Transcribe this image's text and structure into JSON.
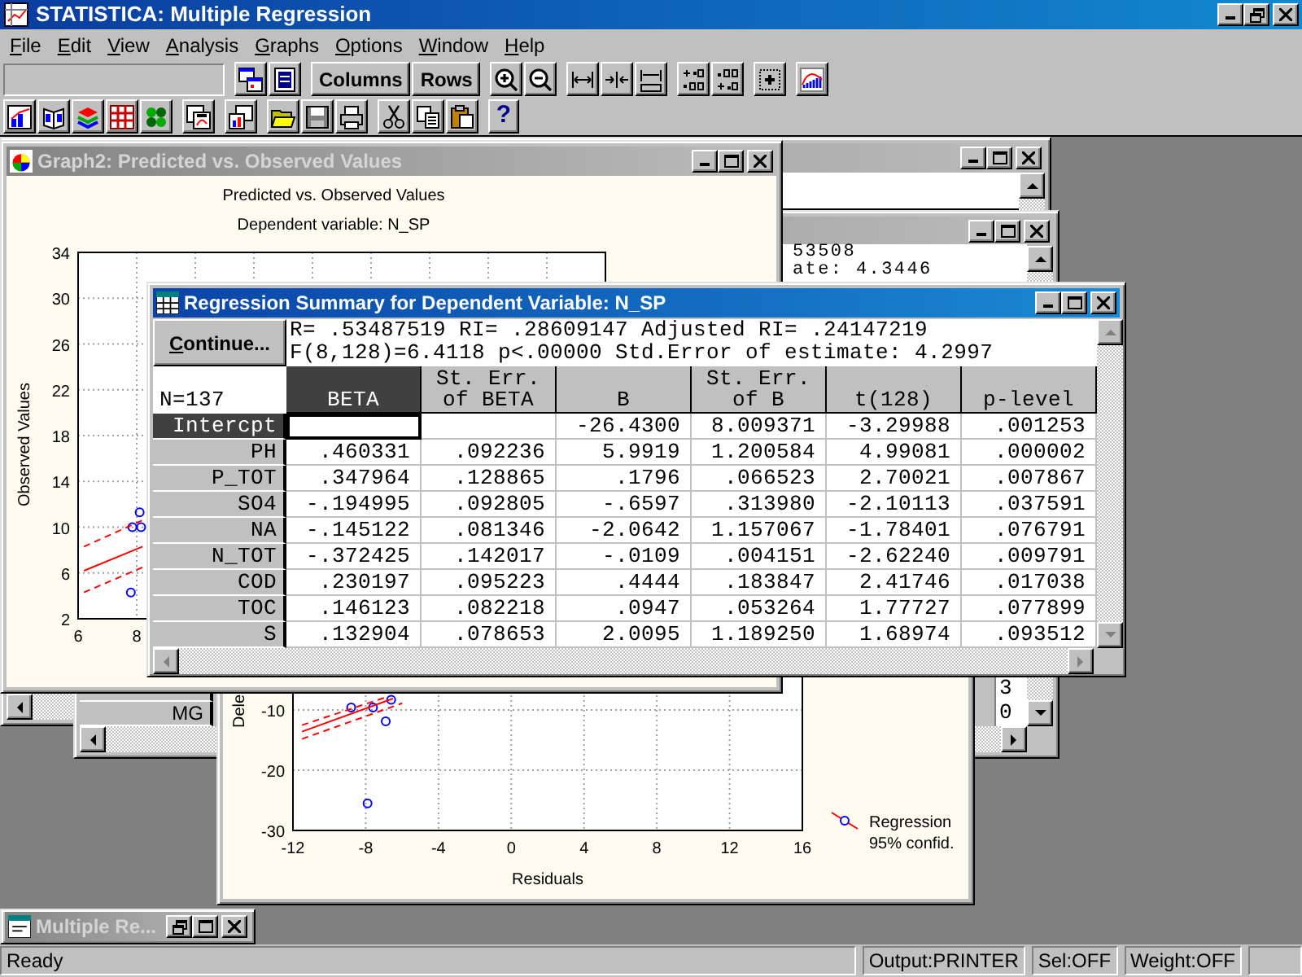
{
  "app": {
    "title": "STATISTICA: Multiple Regression"
  },
  "menu": [
    "File",
    "Edit",
    "View",
    "Analysis",
    "Graphs",
    "Options",
    "Window",
    "Help"
  ],
  "toolbar": {
    "text_buttons": [
      "Columns",
      "Rows"
    ],
    "help_button": "?"
  },
  "windows": [
    {
      "kind": "sheet",
      "active": false
    },
    {
      "kind": "graph",
      "active": false,
      "title": "Graph2: Predicted vs. Observed Values",
      "subtitle": "Dependent variable: N_SP",
      "chart_data": {
        "type": "scatter",
        "title": "Predicted vs. Observed Values",
        "ylabel": "Observed Values",
        "xlim": [
          6,
          24
        ],
        "ylim": [
          2,
          34
        ],
        "xticks": [
          6,
          8
        ],
        "yticks": [
          2,
          6,
          10,
          14,
          18,
          22,
          26,
          30,
          34
        ],
        "grid": true,
        "series": [
          {
            "color": "#0000ff",
            "x": [
              7.8,
              7.85,
              8.15,
              8.1
            ],
            "values": [
              4.3,
              10,
              10,
              11.3
            ]
          },
          {
            "type": "line",
            "color": "#ff0000",
            "x": [
              6.2,
              8.2
            ],
            "values": [
              6.2,
              8.3
            ]
          },
          {
            "type": "line",
            "line_style": "dashed",
            "color": "#ff0000",
            "x": [
              6.2,
              8.2
            ],
            "values": [
              8.3,
              10.6
            ]
          },
          {
            "type": "line",
            "line_style": "dashed",
            "color": "#ff0000",
            "x": [
              6.2,
              8.2
            ],
            "values": [
              4.3,
              6.5
            ]
          }
        ]
      }
    },
    {
      "kind": "sheet",
      "active": false,
      "info_lines": [
        "53508",
        "ate: 4.3446"
      ],
      "rows": [
        {
          "cells": [
            "3"
          ]
        },
        {
          "header": "MG",
          "cells": [
            "0"
          ]
        }
      ]
    },
    {
      "kind": "results",
      "active": true,
      "title": "Regression Summary for Dependent Variable: N_SP",
      "continue_button": "Continue...",
      "info_lines": [
        "R= .53487519 RI= .28609147 Adjusted RI= .24147219",
        "F(8,128)=6.4118 p<.00000 Std.Error of estimate: 4.2997"
      ],
      "n_label": "N=137",
      "columns": [
        {
          "label": "BETA",
          "selected": true
        },
        {
          "label": "St. Err.\nof BETA",
          "selected": false
        },
        {
          "label": "B",
          "selected": false
        },
        {
          "label": "St. Err.\nof B",
          "selected": false
        },
        {
          "label": "t(128)",
          "selected": false
        },
        {
          "label": "p-level",
          "selected": false
        }
      ],
      "rows": [
        {
          "label": "Intercpt",
          "selected": true,
          "cells": [
            "",
            "",
            "-26.4300",
            "8.009371",
            "-3.29988",
            ".001253"
          ]
        },
        {
          "label": "PH",
          "selected": false,
          "cells": [
            ".460331",
            ".092236",
            "5.9919",
            "1.200584",
            "4.99081",
            ".000002"
          ]
        },
        {
          "label": "P_TOT",
          "selected": false,
          "cells": [
            ".347964",
            ".128865",
            ".1796",
            ".066523",
            "2.70021",
            ".007867"
          ]
        },
        {
          "label": "SO4",
          "selected": false,
          "cells": [
            "-.194995",
            ".092805",
            "-.6597",
            ".313980",
            "-2.10113",
            ".037591"
          ]
        },
        {
          "label": "NA",
          "selected": false,
          "cells": [
            "-.145122",
            ".081346",
            "-2.0642",
            "1.157067",
            "-1.78401",
            ".076791"
          ]
        },
        {
          "label": "N_TOT",
          "selected": false,
          "cells": [
            "-.372425",
            ".142017",
            "-.0109",
            ".004151",
            "-2.62240",
            ".009791"
          ]
        },
        {
          "label": "COD",
          "selected": false,
          "cells": [
            ".230197",
            ".095223",
            ".4444",
            ".183847",
            "2.41746",
            ".017038"
          ]
        },
        {
          "label": "TOC",
          "selected": false,
          "cells": [
            ".146123",
            ".082218",
            ".0947",
            ".053264",
            "1.77727",
            ".077899"
          ]
        },
        {
          "label": "S",
          "selected": false,
          "cells": [
            ".132904",
            ".078653",
            "2.0095",
            "1.189250",
            "1.68974",
            ".093512"
          ]
        }
      ]
    },
    {
      "kind": "graph",
      "legend": [
        {
          "label": "Regression"
        },
        {
          "label": "95% confid."
        }
      ],
      "chart_data": {
        "type": "scatter",
        "xlabel": "Residuals",
        "ylabel": "Dele",
        "xlim": [
          -12,
          16
        ],
        "ylim": [
          -30,
          20
        ],
        "xticks": [
          -12,
          -8,
          -4,
          0,
          4,
          8,
          12,
          16
        ],
        "yticks": [
          -10,
          -20,
          -30
        ],
        "grid": true,
        "series": [
          {
            "color": "#0000ff",
            "x": [
              -8.8,
              -7.6,
              -6.9,
              -7.9,
              -6.6
            ],
            "values": [
              -9.6,
              -9.6,
              -11.9,
              -25.5,
              -8.3
            ]
          },
          {
            "type": "line",
            "color": "#ff0000",
            "x": [
              -11.5,
              -6.5
            ],
            "values": [
              -13.6,
              -8.1
            ]
          },
          {
            "type": "line",
            "line_style": "dashed",
            "color": "#ff0000",
            "x": [
              -11.5,
              -7
            ],
            "values": [
              -12.5,
              -8
            ]
          },
          {
            "type": "line",
            "line_style": "dashed",
            "color": "#ff0000",
            "x": [
              -11.5,
              -6
            ],
            "values": [
              -14.8,
              -8.9
            ]
          }
        ]
      }
    }
  ],
  "minimized": {
    "title": "Multiple Re...",
    "active": false
  },
  "status_bar": [
    "Ready",
    "Output:PRINTER",
    "Sel:OFF",
    "Weight:OFF"
  ]
}
